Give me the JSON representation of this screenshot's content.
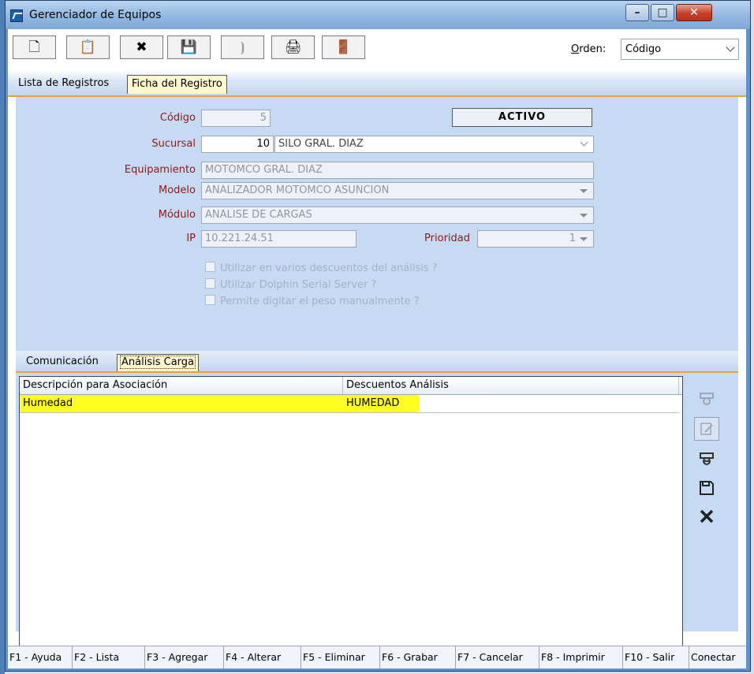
{
  "window": {
    "title": "Gerenciador de Equipos",
    "minimize": "–",
    "maximize": "□",
    "close": "✕"
  },
  "toolbar": {
    "buttons": [
      {
        "name": "new-icon",
        "glyph": "🗋",
        "enabled": true
      },
      {
        "name": "edit-icon",
        "glyph": "📋",
        "enabled": true
      },
      {
        "name": "delete-icon",
        "glyph": "✖",
        "enabled": true
      },
      {
        "name": "save-icon",
        "glyph": "💾",
        "enabled": false
      },
      {
        "name": "connect-icon",
        "glyph": "⦘",
        "enabled": false
      },
      {
        "name": "print-icon",
        "glyph": "🖨",
        "enabled": true
      },
      {
        "name": "exit-icon",
        "glyph": "🚪",
        "enabled": true
      }
    ],
    "orden_label_first": "O",
    "orden_label_rest": "rden:",
    "orden_value": "Código"
  },
  "tabs": [
    {
      "label": "Lista de Registros",
      "active": false
    },
    {
      "label": "Ficha del Registro",
      "active": true
    }
  ],
  "form": {
    "codigo_label": "Código",
    "codigo_value": "5",
    "status": "ACTIVO",
    "sucursal_label": "Sucursal",
    "sucursal_code": "10",
    "sucursal_name": "SILO GRAL. DIAZ",
    "equipamiento_label": "Equipamiento",
    "equipamiento_value": "MOTOMCO GRAL. DIAZ",
    "modelo_label": "Modelo",
    "modelo_value": "ANALIZADOR MOTOMCO ASUNCION",
    "modulo_label": "Módulo",
    "modulo_value": "ANALISE DE CARGAS",
    "ip_label": "IP",
    "ip_value": "10.221.24.51",
    "prioridad_label": "Prioridad",
    "prioridad_value": "1",
    "checkboxes": [
      {
        "label": "Utilizar en varios descuentos del análisis ?",
        "checked": false
      },
      {
        "label": "Utilizar Dolphin Serial Server ?",
        "checked": false
      },
      {
        "label": "Permite digitar el peso manualmente ?",
        "checked": false
      }
    ]
  },
  "subtabs": [
    {
      "label": "Comunicación",
      "active": false
    },
    {
      "label": "Análisis Carga",
      "active": true
    }
  ],
  "grid": {
    "columns": [
      "Descripción para Asociación",
      "Descuentos Análisis"
    ],
    "rows": [
      [
        "Humedad",
        "HUMEDAD"
      ]
    ]
  },
  "function_keys": [
    "F1 - Ayuda",
    "F2 - Lista",
    "F3 - Agregar",
    "F4 - Alterar",
    "F5 - Eliminar",
    "F6 - Grabar",
    "F7 - Cancelar",
    "F8 - Imprimir",
    "F10 - Salir",
    "Conectar"
  ],
  "colors": {
    "label_red": "#8b1b1b",
    "highlight": "#ffff20",
    "tab_accent": "#e6a33d",
    "panel_bg": "#c7daf3"
  }
}
